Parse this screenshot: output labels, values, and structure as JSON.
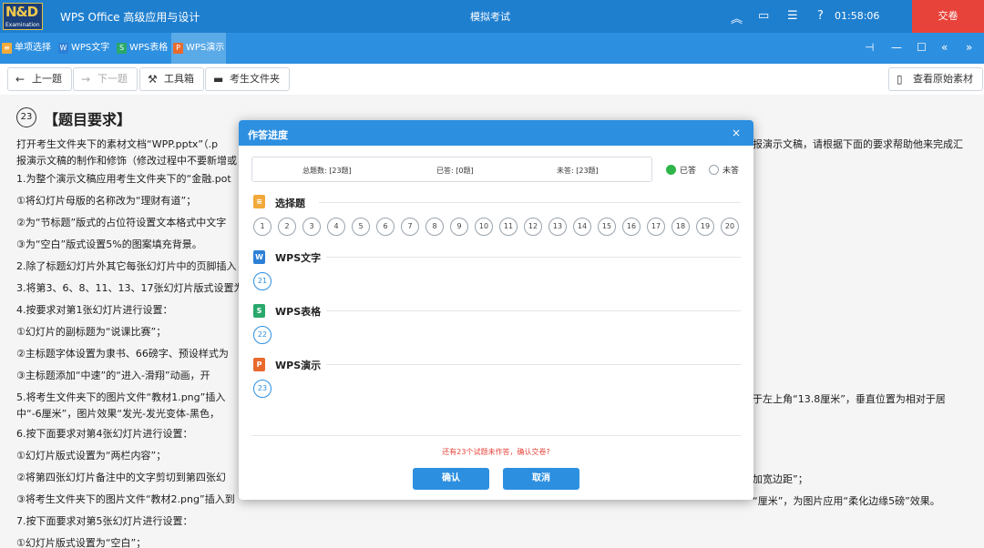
{
  "titlebar": {
    "logo_text": "N&D",
    "logo_sub": "Examination",
    "app_title": "WPS Office 高级应用与设计",
    "mode_title": "模拟考试",
    "timer": "01:58:06",
    "submit_label": "交卷",
    "help_label": "?"
  },
  "tabs": [
    {
      "label": "单项选择",
      "icon": "choice-icon",
      "color": "#f2a93b"
    },
    {
      "label": "WPS文字",
      "icon": "wps-writer-icon",
      "color": "#2d7fd6",
      "glyph": "W"
    },
    {
      "label": "WPS表格",
      "icon": "wps-sheet-icon",
      "color": "#28a86b",
      "glyph": "S"
    },
    {
      "label": "WPS演示",
      "icon": "wps-present-icon",
      "color": "#e86a2c",
      "glyph": "P"
    }
  ],
  "toolbar": {
    "prev_label": "上一题",
    "next_label": "下一题",
    "tools_label": "工具箱",
    "folder_label": "考生文件夹",
    "view_source_label": "查看原始素材"
  },
  "question": {
    "number": "23",
    "title": "【题目要求】",
    "lines": [
      "打开考生文件夹下的素材文档“WPP.pptx”（.p",
      "报演示文稿的制作和修饰（修改过程中不要新增或",
      "1.为整个演示文稿应用考生文件夹下的“金融.pot",
      "①将幻灯片母版的名称改为“理财有道”；",
      "②为“节标题”版式的占位符设置文本格式中文字",
      "③为“空白”版式设置5%的图案填充背景。",
      "2.除了标题幻灯片外其它每张幻灯片中的页脚插入",
      "3.将第3、6、8、11、13、17张幻灯片版式设置为",
      "4.按要求对第1张幻灯片进行设置：",
      "①幻灯片的副标题为“说课比赛”；",
      "②主标题字体设置为隶书、66磅字、预设样式为",
      "③主标题添加“中速”的“进入-滑翔”动画，开",
      "5.将考生文件夹下的图片文件“教材1.png”插入",
      "中“-6厘米”，图片效果“发光-发光变体-黑色，",
      "6.按下面要求对第4张幻灯片进行设置：",
      "①幻灯片版式设置为“两栏内容”；",
      "②将第四张幻灯片备注中的文字剪切到第四张幻",
      "③将考生文件夹下的图片文件“教材2.png”插入到",
      "7.按下面要求对第5张幻灯片进行设置：",
      "①幻灯片版式设置为“空白”；"
    ],
    "right_fragments": {
      "line1": "报演示文稿，请根据下面的要求帮助他来完成汇",
      "line5": "于左上角“13.8厘米”，垂直位置为相对于居",
      "line7": "加宽边距”；",
      "line8": "“厘米”，为图片应用“柔化边缘5磅”效果。"
    }
  },
  "modal": {
    "title": "作答进度",
    "close": "×",
    "stats": {
      "total": "总题数: [23题]",
      "answered": "已答: [0题]",
      "unanswered": "未答: [23题]"
    },
    "legend": {
      "answered": "已答",
      "unanswered": "未答",
      "answered_color": "#2fb54a"
    },
    "sections": [
      {
        "title": "选择题",
        "icon": "choice-section-icon",
        "color": "#f2a93b",
        "questions": [
          "1",
          "2",
          "3",
          "4",
          "5",
          "6",
          "7",
          "8",
          "9",
          "10",
          "11",
          "12",
          "13",
          "14",
          "15",
          "16",
          "17",
          "18",
          "19",
          "20"
        ]
      },
      {
        "title": "WPS文字",
        "icon": "wps-writer-section-icon",
        "color": "#2d7fd6",
        "glyph": "W",
        "questions": [
          "21"
        ]
      },
      {
        "title": "WPS表格",
        "icon": "wps-sheet-section-icon",
        "color": "#28a86b",
        "glyph": "S",
        "questions": [
          "22"
        ]
      },
      {
        "title": "WPS演示",
        "icon": "wps-present-section-icon",
        "color": "#e86a2c",
        "glyph": "P",
        "questions": [
          "23"
        ]
      }
    ],
    "warning": "还有23个试题未作答，确认交卷?",
    "confirm_label": "确认",
    "cancel_label": "取消"
  }
}
